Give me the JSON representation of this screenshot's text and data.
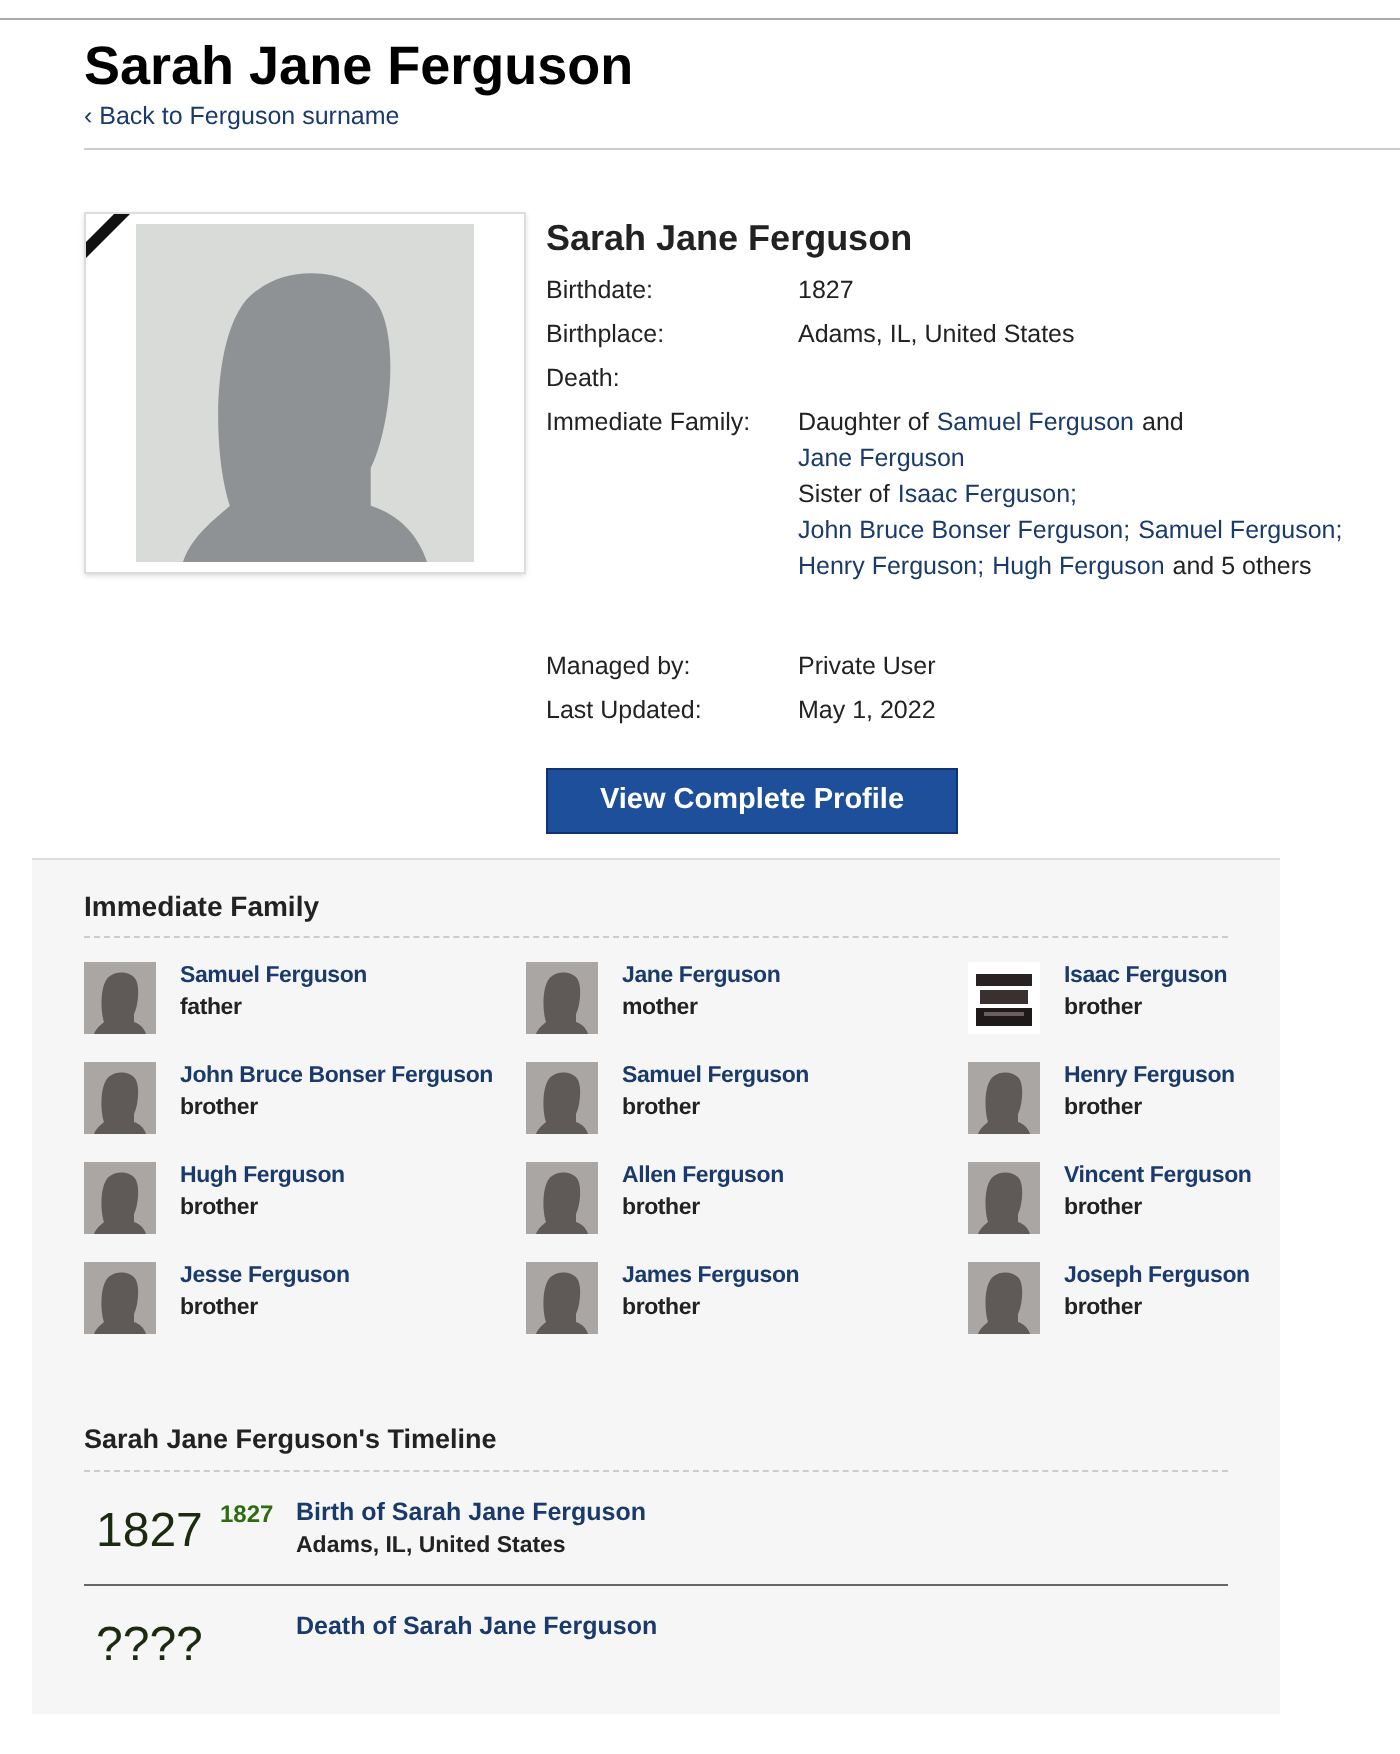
{
  "header": {
    "title": "Sarah Jane Ferguson",
    "back_link": "‹ Back to Ferguson surname"
  },
  "profile": {
    "name": "Sarah Jane Ferguson",
    "deceased": true,
    "facts": [
      {
        "label": "Birthdate:",
        "value": "1827"
      },
      {
        "label": "Birthplace:",
        "value": "Adams, IL, United States"
      },
      {
        "label": "Death:"
      },
      {
        "label": "Immediate Family:",
        "lines": [
          [
            {
              "kind": "text",
              "text": "Daughter of"
            },
            {
              "kind": "link",
              "text": "Samuel Ferguson"
            },
            {
              "kind": "text",
              "text": "and"
            },
            {
              "kind": "link",
              "text": "Jane Ferguson"
            }
          ],
          [
            {
              "kind": "text",
              "text": "Sister of"
            },
            {
              "kind": "link",
              "text": "Isaac Ferguson;"
            },
            {
              "kind": "link",
              "text": "John Bruce Bonser Ferguson;"
            },
            {
              "kind": "link",
              "text": "Samuel Ferguson;"
            },
            {
              "kind": "link",
              "text": "Henry Ferguson;"
            },
            {
              "kind": "link",
              "text": "Hugh Ferguson"
            },
            {
              "kind": "text",
              "text": "and 5 others"
            }
          ]
        ]
      }
    ],
    "meta": [
      {
        "label": "Managed by:",
        "value": "Private User"
      },
      {
        "label": "Last Updated:",
        "value": "May 1, 2022"
      }
    ],
    "button": "View Complete Profile"
  },
  "family": {
    "title": "Immediate Family",
    "members": [
      {
        "name": "Samuel Ferguson",
        "relation": "father",
        "kind": "silhouette"
      },
      {
        "name": "Jane Ferguson",
        "relation": "mother",
        "kind": "silhouette"
      },
      {
        "name": "Isaac Ferguson",
        "relation": "brother",
        "kind": "picture"
      },
      {
        "name": "John Bruce Bonser Ferguson",
        "relation": "brother",
        "kind": "silhouette"
      },
      {
        "name": "Samuel Ferguson",
        "relation": "brother",
        "kind": "silhouette"
      },
      {
        "name": "Henry Ferguson",
        "relation": "brother",
        "kind": "silhouette"
      },
      {
        "name": "Hugh Ferguson",
        "relation": "brother",
        "kind": "silhouette"
      },
      {
        "name": "Allen Ferguson",
        "relation": "brother",
        "kind": "silhouette"
      },
      {
        "name": "Vincent Ferguson",
        "relation": "brother",
        "kind": "silhouette"
      },
      {
        "name": "Jesse Ferguson",
        "relation": "brother",
        "kind": "silhouette"
      },
      {
        "name": "James Ferguson",
        "relation": "brother",
        "kind": "silhouette"
      },
      {
        "name": "Joseph Ferguson",
        "relation": "brother",
        "kind": "silhouette"
      }
    ]
  },
  "timeline": {
    "title": "Sarah Jane Ferguson's Timeline",
    "events": [
      {
        "year": "1827",
        "age": "1827",
        "title": "Birth of Sarah Jane Ferguson",
        "place": "Adams, IL, United States"
      },
      {
        "year": "????",
        "title": "Death of Sarah Jane Ferguson"
      }
    ]
  }
}
